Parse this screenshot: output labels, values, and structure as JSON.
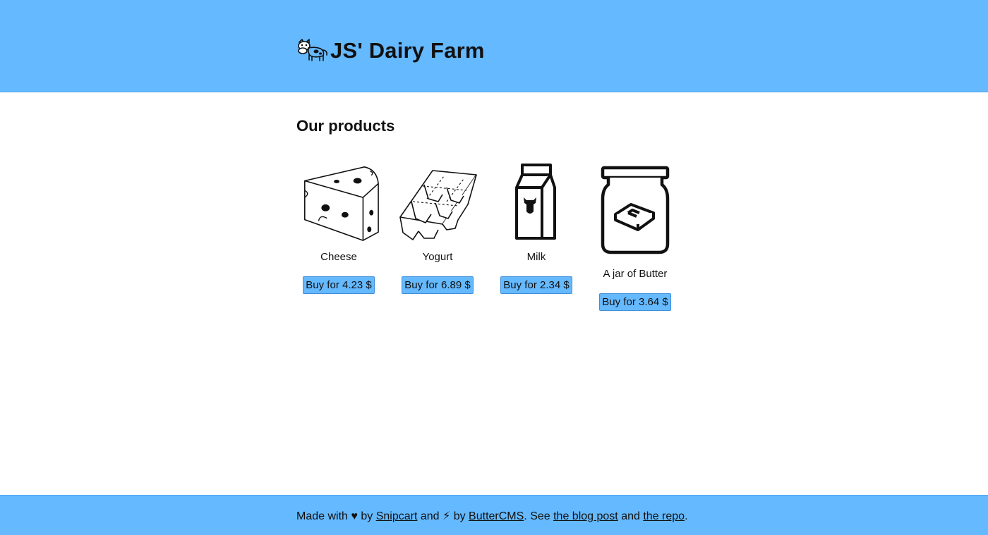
{
  "header": {
    "site_title": "JS' Dairy Farm",
    "logo_icon": "cow-icon",
    "background_color": "#65b9ff"
  },
  "main": {
    "section_title": "Our products",
    "products": [
      {
        "name": "Cheese",
        "button_label": "Buy for 4.23 $",
        "icon": "cheese-icon"
      },
      {
        "name": "Yogurt",
        "button_label": "Buy for 6.89 $",
        "icon": "yogurt-icon"
      },
      {
        "name": "Milk",
        "button_label": "Buy for 2.34 $",
        "icon": "milk-carton-icon"
      },
      {
        "name": "A jar of Butter",
        "button_label": "Buy for 3.64 $",
        "icon": "butter-jar-icon"
      }
    ]
  },
  "footer": {
    "made_with": "Made with",
    "heart": "♥",
    "by1": "by",
    "snipcart_link": "Snipcart",
    "and1": "and",
    "lightning": "⚡",
    "by2": "by",
    "buttercms_link": "ButterCMS",
    "see": ". See",
    "blog_post_link": "the blog post",
    "and2": "and",
    "repo_link": "the repo",
    "period": "."
  }
}
